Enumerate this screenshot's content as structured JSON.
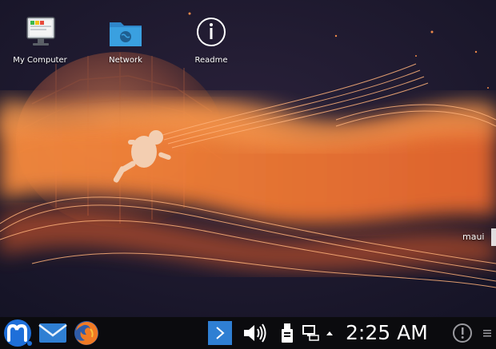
{
  "desktop": {
    "icons": [
      {
        "label": "My Computer",
        "icon": "computer-icon"
      },
      {
        "label": "Network",
        "icon": "network-folder-icon"
      },
      {
        "label": "Readme",
        "icon": "info-icon"
      }
    ],
    "username": "maui"
  },
  "taskbar": {
    "launchers": [
      {
        "name": "start-menu",
        "icon": "maui-logo-icon"
      },
      {
        "name": "mail",
        "icon": "mail-icon"
      },
      {
        "name": "firefox",
        "icon": "firefox-icon"
      }
    ],
    "tray": [
      {
        "name": "show-hidden",
        "icon": "chevron-right-icon"
      },
      {
        "name": "volume",
        "icon": "speaker-icon"
      },
      {
        "name": "usb-device",
        "icon": "usb-icon"
      },
      {
        "name": "network",
        "icon": "network-monitor-icon"
      },
      {
        "name": "expand-tray",
        "icon": "arrow-up-icon"
      },
      {
        "name": "notifications",
        "icon": "alert-icon"
      },
      {
        "name": "menu",
        "icon": "hamburger-icon"
      }
    ],
    "clock": "2:25 AM"
  },
  "colors": {
    "wallpaper_dark": "#17162a",
    "wallpaper_orange": "#f07a34",
    "taskbar_bg": "#0b0b0e",
    "folder_blue": "#3aa0e0",
    "tray_highlight": "#2f7fd3"
  }
}
